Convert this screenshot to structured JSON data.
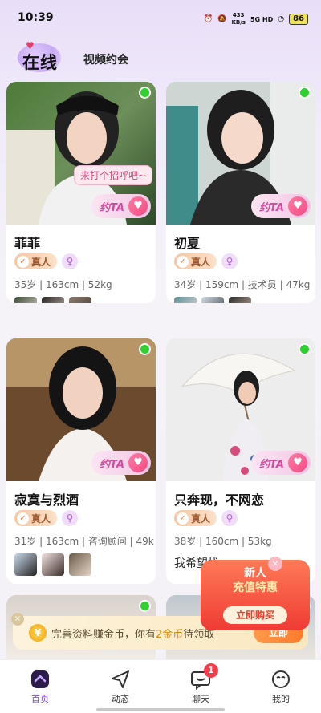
{
  "status": {
    "time": "10:39",
    "speed": "433",
    "speed_unit": "KB/s",
    "network": "5G HD",
    "battery": "86"
  },
  "header": {
    "tab_online": "在线",
    "tab_video": "视频约会"
  },
  "date_label": "约TA",
  "real_label": "真人",
  "cards": [
    {
      "name": "菲菲",
      "info": "35岁 | 163cm | 52kg",
      "greeting": "来打个招呼吧~"
    },
    {
      "name": "初夏",
      "info": "34岁 | 159cm | 技术员 | 47kg"
    },
    {
      "name": "寂寞与烈酒",
      "info": "31岁 | 163cm | 咨询顾问 | 49k"
    },
    {
      "name": "只奔现，不网恋",
      "info": "38岁 | 160cm | 53kg",
      "bio": "我希望找"
    }
  ],
  "promo": {
    "line1": "新人",
    "line2": "充值特惠",
    "button": "立即购买",
    "close": "×"
  },
  "notice": {
    "prefix": "完善资料赚金币，你有",
    "highlight": "2金币",
    "suffix": "待领取",
    "button": "立即",
    "close": "×"
  },
  "tabbar": {
    "home": "首页",
    "moments": "动态",
    "chat": "聊天",
    "chat_badge": "1",
    "mine": "我的"
  },
  "colors": {
    "accent": "#7a3fd8",
    "online": "#2ed12e",
    "badge": "#f23d4a"
  }
}
